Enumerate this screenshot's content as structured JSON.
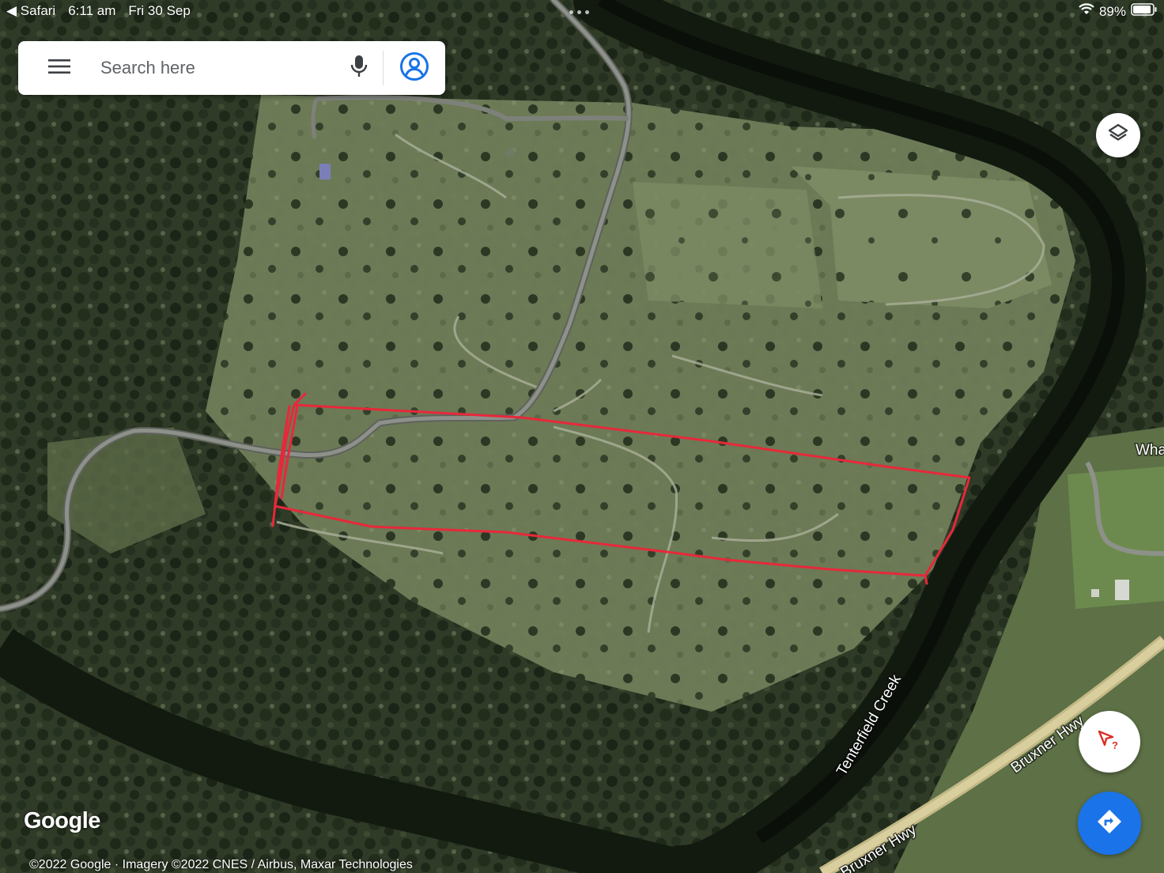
{
  "status_bar": {
    "back_app": "Safari",
    "time": "6:11 am",
    "date": "Fri 30 Sep",
    "battery": "89%"
  },
  "search": {
    "placeholder": "Search here"
  },
  "map": {
    "labels": {
      "creek": "Tenterfield Creek",
      "highway_upper": "Bruxner Hwy",
      "highway_lower": "Bruxner Hwy",
      "edge_label": "Wha"
    },
    "logo": "Google",
    "attribution": "©2022 Google · Imagery ©2022 CNES / Airbus, Maxar Technologies"
  },
  "colors": {
    "boundary_marker": "#e8283a",
    "directions_button": "#1a73e8",
    "account_icon": "#1a73e8"
  },
  "icons": [
    "menu-icon",
    "microphone-icon",
    "account-icon",
    "layers-icon",
    "navigation-icon",
    "directions-icon",
    "wifi-icon",
    "battery-icon"
  ]
}
